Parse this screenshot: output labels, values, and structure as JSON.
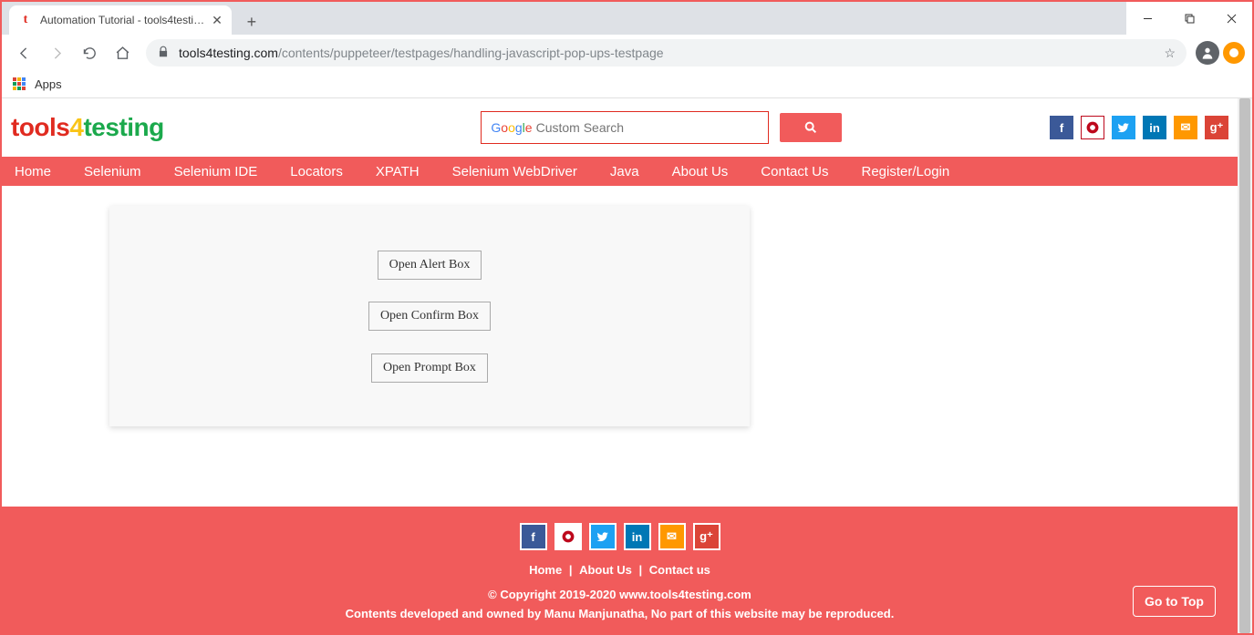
{
  "browser": {
    "tab_title": "Automation Tutorial - tools4testi…",
    "url_host": "tools4testing.com",
    "url_path": "/contents/puppeteer/testpages/handling-javascript-pop-ups-testpage",
    "bookmark_apps": "Apps"
  },
  "logo": {
    "a": "tools",
    "b": "4",
    "c": "testing"
  },
  "search": {
    "google": "Google",
    "placeholder": "Custom Search"
  },
  "nav": [
    "Home",
    "Selenium",
    "Selenium IDE",
    "Locators",
    "XPATH",
    "Selenium WebDriver",
    "Java",
    "About Us",
    "Contact Us",
    "Register/Login"
  ],
  "buttons": {
    "alert": "Open Alert Box",
    "confirm": "Open Confirm Box",
    "prompt": "Open Prompt Box"
  },
  "footer": {
    "links": [
      "Home",
      "About Us",
      "Contact us"
    ],
    "copy": "© Copyright 2019-2020 www.tools4testing.com",
    "disclaimer": "Contents developed and owned by Manu Manjunatha, No part of this website may be reproduced.",
    "goto": "Go to Top"
  }
}
